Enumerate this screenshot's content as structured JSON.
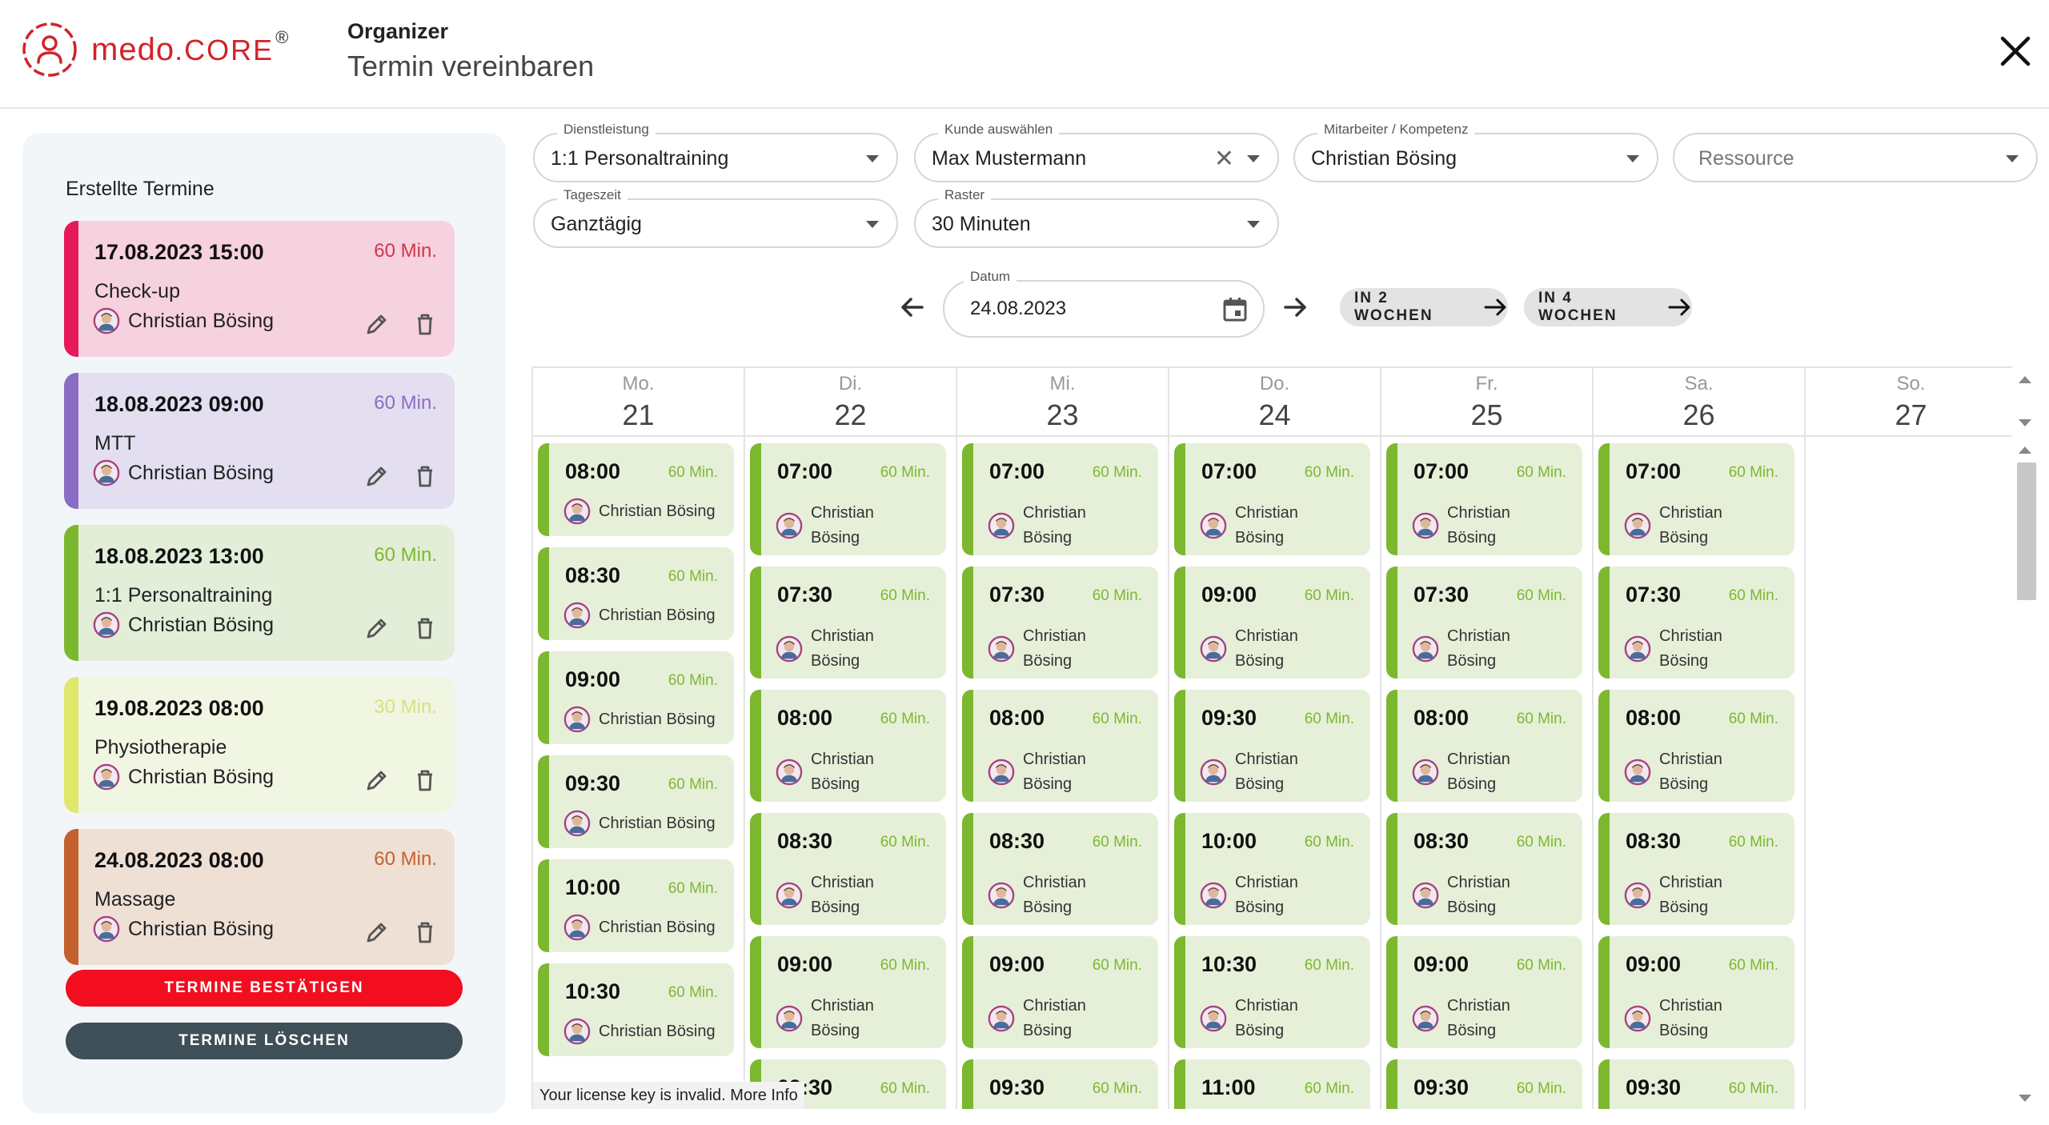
{
  "brand": {
    "name_a": "medo",
    "name_b": ".CORE",
    "reg": "®",
    "color": "#d1232a"
  },
  "header": {
    "title": "Organizer",
    "subtitle": "Termin vereinbaren"
  },
  "sidebar": {
    "title": "Erstellte Termine",
    "appointments": [
      {
        "datetime": "17.08.2023 15:00",
        "duration": "60 Min.",
        "service": "Check-up",
        "person": "Christian Bösing",
        "bg": "#f6d1de",
        "bar": "#e6195a",
        "durColor": "#d1364d"
      },
      {
        "datetime": "18.08.2023 09:00",
        "duration": "60 Min.",
        "service": "MTT",
        "person": "Christian Bösing",
        "bg": "#e3def0",
        "bar": "#8b6cc4",
        "durColor": "#8b6cc4"
      },
      {
        "datetime": "18.08.2023 13:00",
        "duration": "60 Min.",
        "service": "1:1 Personaltraining",
        "person": "Christian Bösing",
        "bg": "#e2eed8",
        "bar": "#7cb82f",
        "durColor": "#7cb82f"
      },
      {
        "datetime": "19.08.2023 08:00",
        "duration": "30 Min.",
        "service": "Physiotherapie",
        "person": "Christian Bösing",
        "bg": "#f0f6e2",
        "bar": "#dfe86a",
        "durColor": "#d9e07e"
      },
      {
        "datetime": "24.08.2023 08:00",
        "duration": "60 Min.",
        "service": "Massage",
        "person": "Christian Bösing",
        "bg": "#efe0d6",
        "bar": "#c2612b",
        "durColor": "#c2612b"
      }
    ],
    "confirm_label": "TERMINE BESTÄTIGEN",
    "delete_label": "TERMINE LÖSCHEN"
  },
  "filters": {
    "dienstleistung": {
      "label": "Dienstleistung",
      "value": "1:1 Personaltraining"
    },
    "kunde": {
      "label": "Kunde auswählen",
      "value": "Max Mustermann"
    },
    "mitarbeiter": {
      "label": "Mitarbeiter / Kompetenz",
      "value": "Christian Bösing"
    },
    "ressource": {
      "placeholder": "Ressource"
    },
    "tageszeit": {
      "label": "Tageszeit",
      "value": "Ganztägig"
    },
    "raster": {
      "label": "Raster",
      "value": "30 Minuten"
    },
    "datum": {
      "label": "Datum",
      "value": "24.08.2023"
    },
    "in2": "IN 2 WOCHEN",
    "in4": "IN 4 WOCHEN"
  },
  "calendar": {
    "days": [
      {
        "name": "Mo.",
        "date": "21",
        "slots": [
          "08:00",
          "08:30",
          "09:00",
          "09:30",
          "10:00",
          "10:30"
        ],
        "compact": true
      },
      {
        "name": "Di.",
        "date": "22",
        "slots": [
          "07:00",
          "07:30",
          "08:00",
          "08:30",
          "09:00",
          "09:30"
        ],
        "compact": false
      },
      {
        "name": "Mi.",
        "date": "23",
        "slots": [
          "07:00",
          "07:30",
          "08:00",
          "08:30",
          "09:00",
          "09:30"
        ],
        "compact": false
      },
      {
        "name": "Do.",
        "date": "24",
        "slots": [
          "07:00",
          "09:00",
          "09:30",
          "10:00",
          "10:30",
          "11:00"
        ],
        "compact": false
      },
      {
        "name": "Fr.",
        "date": "25",
        "slots": [
          "07:00",
          "07:30",
          "08:00",
          "08:30",
          "09:00",
          "09:30"
        ],
        "compact": false
      },
      {
        "name": "Sa.",
        "date": "26",
        "slots": [
          "07:00",
          "07:30",
          "08:00",
          "08:30",
          "09:00",
          "09:30"
        ],
        "compact": false
      },
      {
        "name": "So.",
        "date": "27",
        "slots": [],
        "compact": false
      }
    ],
    "slot_duration": "60 Min.",
    "slot_person": "Christian Bösing",
    "slot_person_first": "Christian",
    "slot_person_last": "Bösing",
    "slot_bg": "#e6f0d9",
    "slot_accent": "#7cb82f"
  },
  "license": {
    "text": "Your license key is invalid.",
    "link": "More Info"
  }
}
